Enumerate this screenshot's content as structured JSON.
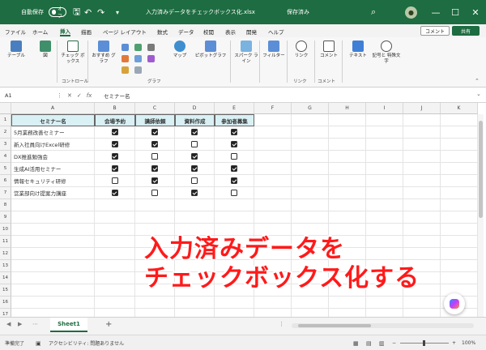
{
  "titlebar": {
    "autosave_label": "自動保存",
    "autosave_state": "オフ",
    "doc_title": "入力済みデータをチェックボックス化.xlsx",
    "saved": "保存済み",
    "undo_glyph": "↶",
    "redo_glyph": "↷",
    "save_glyph": "🖫",
    "minimize_glyph": "—",
    "maximize_glyph": "☐",
    "close_glyph": "✕",
    "accent_color": "#1e6c41"
  },
  "tabs": [
    "ファイル",
    "ホーム",
    "挿入",
    "描画",
    "ページ レイアウト",
    "数式",
    "データ",
    "校閲",
    "表示",
    "開発",
    "ヘルプ"
  ],
  "active_tab": "挿入",
  "comment_button": "コメント",
  "share_button": "共有",
  "ribbon": {
    "buttons": [
      "テーブル",
      "図",
      "チェック ボックス",
      "おすすめ グラフ",
      "マップ",
      "ピボットグラフ",
      "スパーク ライン",
      "フィルター",
      "リンク",
      "コメント",
      "テキスト",
      "記号と 特殊文字"
    ],
    "groups": [
      "コントロール",
      "グラフ",
      "リンク",
      "コメント"
    ]
  },
  "formula_bar": {
    "name_box": "A1",
    "value": "セミナー名"
  },
  "columns": [
    "A",
    "B",
    "C",
    "D",
    "E",
    "F",
    "G",
    "H",
    "I",
    "J",
    "K"
  ],
  "rows": [
    "1",
    "2",
    "3",
    "4",
    "5",
    "6",
    "7",
    "8",
    "9",
    "10",
    "11",
    "12",
    "13",
    "14",
    "15",
    "16",
    "17"
  ],
  "table": {
    "headers": [
      "セミナー名",
      "会場予約",
      "講師依頼",
      "資料作成",
      "参加者募集"
    ],
    "items": [
      {
        "name": "5月業務改善セミナー",
        "checks": [
          true,
          true,
          true,
          true
        ]
      },
      {
        "name": "新入社員向けExcel研修",
        "checks": [
          true,
          true,
          false,
          true
        ]
      },
      {
        "name": "DX推進勉強会",
        "checks": [
          true,
          false,
          true,
          false
        ]
      },
      {
        "name": "生成AI活用セミナー",
        "checks": [
          true,
          true,
          true,
          true
        ]
      },
      {
        "name": "情報セキュリティ研修",
        "checks": [
          false,
          true,
          false,
          true
        ]
      },
      {
        "name": "営業部向け提案力講座",
        "checks": [
          true,
          false,
          true,
          false
        ]
      }
    ],
    "header_fill": "#d9f0f4"
  },
  "overlay": {
    "line1": "入力済みデータを",
    "line2": "チェックボックス化する",
    "color": "#ff1a1a"
  },
  "sheet_tab": "Sheet1",
  "add_sheet_glyph": "+",
  "statusbar": {
    "ready": "準備完了",
    "accessibility": "アクセシビリティ: 問題ありません",
    "zoom": "100%"
  }
}
